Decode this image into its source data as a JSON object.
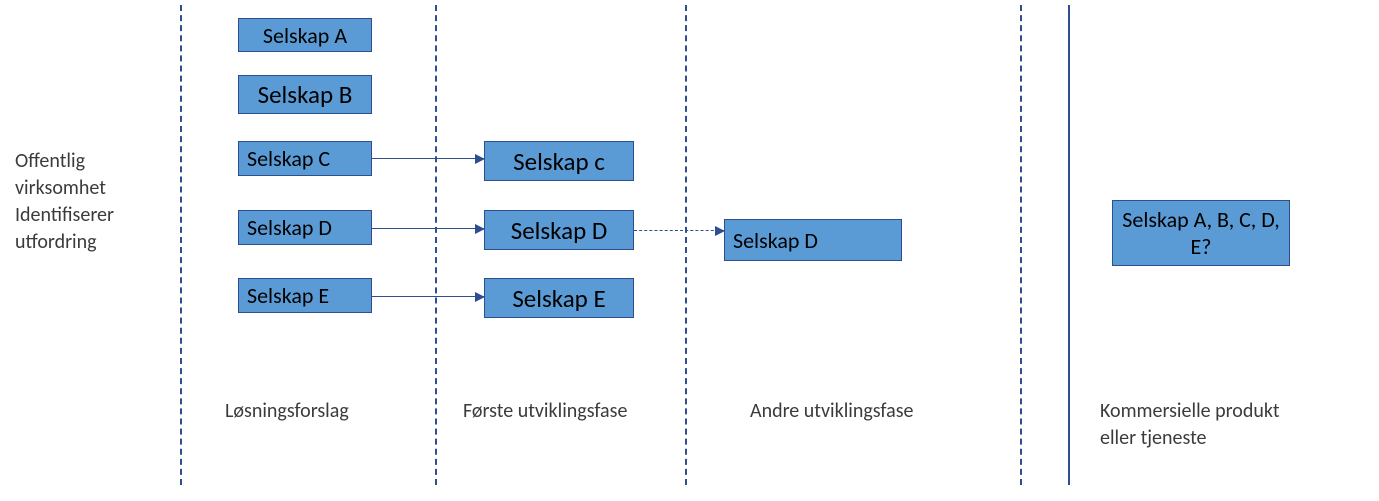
{
  "intro": "Offentlig virksomhet Identifiserer utfordring",
  "phases": {
    "p1": "Løsningsforslag",
    "p2": "Første utviklingsfase",
    "p3": "Andre utviklingsfase",
    "p4": "Kommersielle produkt eller tjeneste"
  },
  "boxes": {
    "col1": {
      "a": "Selskap  A",
      "b": "Selskap B",
      "c": "Selskap C",
      "d": "Selskap D",
      "e": "Selskap E"
    },
    "col2": {
      "c": "Selskap c",
      "d": "Selskap D",
      "e": "Selskap E"
    },
    "col3": {
      "d": "Selskap D"
    },
    "col4": {
      "final": "Selskap A, B, C, D, E?"
    }
  },
  "colors": {
    "box_fill": "#5b9bd5",
    "box_border": "#2e4f8f",
    "text": "#3b3b3b"
  }
}
